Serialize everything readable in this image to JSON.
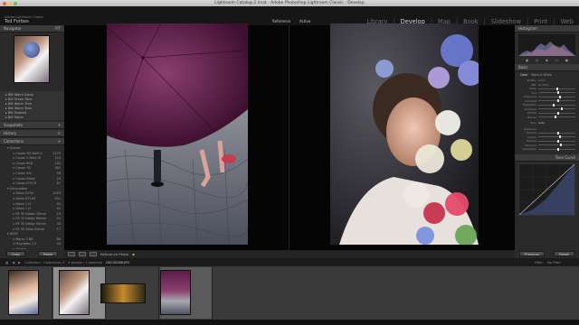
{
  "window": {
    "title": "Lightroom Catalog-2.lrcat - Adobe Photoshop Lightroom Classic - Develop",
    "traffic_lights": {
      "close": "#ec5f57",
      "minimize": "#f5be4f",
      "zoom": "#5fc454"
    }
  },
  "identity": {
    "line1": "Adobe Lightroom Classic",
    "line2": "Ted Forbes"
  },
  "modules": [
    "Library",
    "Develop",
    "Map",
    "Book",
    "Slideshow",
    "Print",
    "Web"
  ],
  "active_module": "Develop",
  "left_panel": {
    "navigator_label": "Navigator",
    "navigator_zoom": "FIT",
    "presets_label": "Presets",
    "presets": [
      "BW Warm Sepia",
      "BW Green Tone",
      "BW Warm Tone",
      "BW Warm Tone",
      "BW Toasted",
      "BW Warm"
    ],
    "snapshots_label": "Snapshots",
    "history_label": "History",
    "collections_label": "Collections",
    "collections": [
      {
        "name": "Sunset",
        "count": "",
        "sub": false
      },
      {
        "name": "Canon 5D Mark II",
        "count": "2175",
        "sub": true
      },
      {
        "name": "Canon 5 Mark III",
        "count": "213",
        "sub": true
      },
      {
        "name": "Canon 60D",
        "count": "145",
        "sub": true
      },
      {
        "name": "Canon 7D",
        "count": "382",
        "sub": true
      },
      {
        "name": "Canon XSi",
        "count": "58",
        "sub": true
      },
      {
        "name": "Canon Rebel",
        "count": "24",
        "sub": true
      },
      {
        "name": "Canon EOS M",
        "count": "87",
        "sub": true
      },
      {
        "name": "Canonettes",
        "count": "",
        "sub": false
      },
      {
        "name": "Nikon D750",
        "count": "1023",
        "sub": true
      },
      {
        "name": "Nikon D7100",
        "count": "431",
        "sub": true
      },
      {
        "name": "Nikon 1 J3",
        "count": "62",
        "sub": true
      },
      {
        "name": "Nikon 1 J1",
        "count": "41",
        "sub": true
      },
      {
        "name": "RF 35 Nikkor 35mm",
        "count": "19",
        "sub": true
      },
      {
        "name": "RF 35 Nikkor 85mm",
        "count": "22",
        "sub": true
      },
      {
        "name": "RF 35 Nikkor 50mm",
        "count": "33",
        "sub": true
      },
      {
        "name": "RF 35 Zeiss 50mm",
        "count": "17",
        "sub": true
      },
      {
        "name": "DSLR",
        "count": "",
        "sub": false
      },
      {
        "name": "Marco 2 Bit",
        "count": "88",
        "sub": true
      },
      {
        "name": "Playdates 1.5",
        "count": "44",
        "sub": true
      },
      {
        "name": "Search",
        "count": "",
        "sub": true
      },
      {
        "name": "Focal Length",
        "count": "",
        "sub": false
      },
      {
        "name": "Landscapes",
        "count": "",
        "sub": false
      },
      {
        "name": "Portraits",
        "count": "",
        "sub": false
      },
      {
        "name": "Stuff 3 Ph",
        "count": "",
        "sub": false
      },
      {
        "name": "Stuffed Bit",
        "count": "7",
        "sub": true
      },
      {
        "name": "Stuffed 2 Bit",
        "count": "12",
        "sub": true
      }
    ],
    "import_button": "Copy",
    "export_button": "Paste"
  },
  "center": {
    "reference_label": "Reference",
    "active_label": "Active"
  },
  "toolbar": {
    "mode_label": "Reference Photo",
    "indicator": "◆"
  },
  "right_panel": {
    "histogram_label": "Histogram",
    "basic_label": "Basic",
    "treatment": [
      "Color",
      "Black & White"
    ],
    "profile_label": "Profile:",
    "profile_value": "Color",
    "wb_label": "WB:",
    "wb_value": "As Shot",
    "tone_label": "Tone",
    "tone_auto": "Auto",
    "sliders": [
      {
        "label": "Temp",
        "value": 0.48
      },
      {
        "label": "Tint",
        "value": 0.52
      },
      {
        "label": "Exposure",
        "value": 0.55
      },
      {
        "label": "Contrast",
        "value": 0.5
      },
      {
        "label": "Highlights",
        "value": 0.4
      },
      {
        "label": "Shadows",
        "value": 0.6
      },
      {
        "label": "Whites",
        "value": 0.5
      },
      {
        "label": "Blacks",
        "value": 0.45
      }
    ],
    "presence_label": "Presence",
    "presence_sliders": [
      {
        "label": "Texture",
        "value": 0.5
      },
      {
        "label": "Clarity",
        "value": 0.55
      },
      {
        "label": "Dehaze",
        "value": 0.5
      },
      {
        "label": "Vibrance",
        "value": 0.58
      },
      {
        "label": "Saturation",
        "value": 0.5
      }
    ],
    "tone_curve_label": "Tone Curve",
    "previous_button": "Previous",
    "reset_button": "Reset"
  },
  "filmbar": {
    "path": "Collection : Collections 3",
    "count": "5 photos / 1 selected",
    "filename": "DSC00286.JPG",
    "filter_label": "Filter:",
    "filter_value": "No Filter"
  },
  "filmstrip": {
    "cells": 4,
    "selected_index": 1
  }
}
